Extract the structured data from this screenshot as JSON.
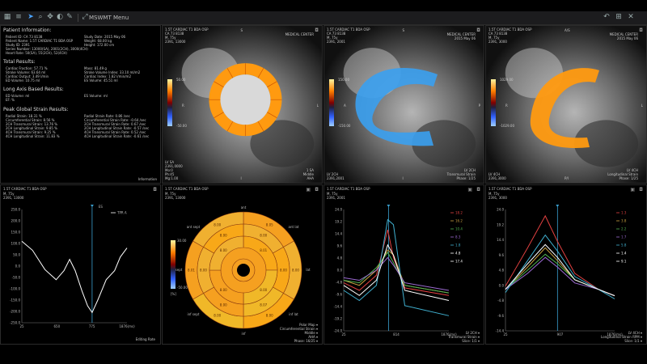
{
  "app": {
    "title": "MSWMT Menu"
  },
  "info": {
    "patient_header": "Patient Information:",
    "patient_left": [
      "Patient ID: CA 73 8138",
      "Patient Name: 1.5T CARDIAC T1 BDA OSP",
      "Study ID: 2391",
      "Series Number: 13000(SA), 2001(2CH), 3000(4CH)",
      "Heart Rate: 50(SA), 55(2CH), 52(4CH)"
    ],
    "patient_right": [
      "Study Date: 2015 May 06",
      "Weight: 68.00 kg",
      "Height: 172.00 cm"
    ],
    "total_header": "Total Results:",
    "total_left": [
      "Cardiac Fraction: 57.71 %",
      "Stroke Volume: 63.64 ml",
      "Cardiac Output: 3.49 l/min",
      "ED Volume: 10.75 ml"
    ],
    "total_right": [
      "Mass: 81.49 g",
      "Stroke Volume Index: 33.10 ml/m2",
      "Cardiac Index: 1.82 l/min/m2",
      "ES Volume: 45.51 ml"
    ],
    "long_header": "Long Axis Based Results:",
    "long_left": [
      "ED Volume: ml",
      "EF: %"
    ],
    "long_right": [
      "ES Volume: ml"
    ],
    "strain_header": "Peak Global Strain Results:",
    "strain_left": [
      "Radial Strain: 18.31 %",
      "Circumferential Strain: 8.56 %",
      "2CH Transmural Strain: 13.76 %",
      "2CH Longitudinal Strain: 9.85 %",
      "4CH Transmural Strain: 9.25 %",
      "4CH Longitudinal Strain: 11.83 %"
    ],
    "strain_right": [
      "Radial Strain Rate: 0.86 /sec",
      "Circumferential Strain Rate: -0.64 /sec",
      "2CH Transmural Strain Rate: 0.67 /sec",
      "2CH Longitudinal Strain Rate: -0.57 /sec",
      "4CH Transmural Strain Rate: 0.52 /sec",
      "4CH Longitudinal Strain Rate: -0.61 /sec"
    ],
    "footer": "Information"
  },
  "mri": [
    {
      "title": "1.5T CARDIAC T1 BDA OSP",
      "sub": "CA 73 8138",
      "meta": [
        "M, 75y",
        "2391, 13000",
        "",
        "",
        ""
      ],
      "right_meta": [
        "MEDICAL CENTER"
      ],
      "scale_top": "50.00",
      "scale_bot": "-50.00",
      "dir_top": "S",
      "dir_left": "R",
      "dir_right": "L",
      "dir_bot": "I",
      "bl": [
        "LV SA",
        "2391,0000",
        "Mo:0",
        "Ph:45",
        "Mg:1.00"
      ],
      "br": [
        "1 SA",
        "Middle",
        "AHA"
      ],
      "footer": ""
    },
    {
      "title": "1.5T CARDIAC T1 BDA OSP",
      "sub": "CA 73 8138",
      "meta": [
        "M, 75y",
        "2391, 2001"
      ],
      "right_meta": [
        "MEDICAL CENTER",
        "2015 May 06"
      ],
      "scale_top": "150.00",
      "scale_bot": "-150.00",
      "dir_top": "S",
      "dir_left": "A",
      "dir_right": "P",
      "dir_bot": "I",
      "bl": [
        "LV 2CH",
        "2391,2001"
      ],
      "br": [
        "LV 2CH",
        "Transmural Strain",
        "Phase: 1/25"
      ],
      "footer": ""
    },
    {
      "title": "1.5T CARDIAC T1 BDA OSP",
      "sub": "CA 73 8138",
      "meta": [
        "M, 75y",
        "2391, 3000"
      ],
      "right_meta": [
        "MEDICAL CENTER",
        "2015 May 06"
      ],
      "scale_top": "1029.00",
      "scale_bot": "-1029.00",
      "dir_top": "A/S",
      "dir_left": "R",
      "dir_right": "L",
      "dir_bot": "P/I",
      "bl": [
        "LV 4CH",
        "2391,3000"
      ],
      "br": [
        "LV 4CH",
        "Longitudinal Strain",
        "Phase: 1/25"
      ],
      "footer": ""
    }
  ],
  "curve": {
    "title": "1.5T CARDIAC T1 BDA OSP",
    "meta": [
      "M, 75y",
      "2391, 13000"
    ],
    "chart_data": {
      "type": "line",
      "ylim": [
        -250,
        250
      ],
      "yticks": [
        "250.0",
        "200.0",
        "150.0",
        "100.0",
        "50.0",
        "0.0",
        "-50.0",
        "-100.0",
        "-150.0",
        "-200.0",
        "-250.0"
      ],
      "xticks": [
        "25",
        "650",
        "775",
        "1876(ms)"
      ],
      "legend": "TPR A",
      "series": [
        {
          "values": [
            [
              25,
              110
            ],
            [
              120,
              70
            ],
            [
              230,
              -15
            ],
            [
              330,
              -60
            ],
            [
              400,
              -20
            ],
            [
              450,
              30
            ],
            [
              500,
              -20
            ],
            [
              560,
              -110
            ],
            [
              610,
              -175
            ],
            [
              650,
              -205
            ],
            [
              700,
              -150
            ],
            [
              775,
              -60
            ],
            [
              850,
              -20
            ],
            [
              900,
              40
            ],
            [
              960,
              80
            ]
          ]
        }
      ],
      "marker_x": 650,
      "marker_label": "ES"
    },
    "footer": "Editing Rate"
  },
  "bullseye": {
    "title": "1.5T CARDIAC T1 BDA OSP",
    "meta": [
      "M, 75y",
      "2391, 13000"
    ],
    "scale_top": "30.00",
    "scale_bot": "-50.00",
    "scale_unit": "[%]",
    "labels": {
      "top": "ant",
      "bottom": "inf",
      "left": "sept",
      "right": "lat",
      "ant_sept": "ant sept",
      "inf_sept": "inf sept",
      "ant_lat": "ant lat",
      "inf_lat": "inf lat"
    },
    "segments": [
      "8.05",
      "8.00",
      "8.00",
      "8.00",
      "8.01",
      "8.00",
      "8.00",
      "8.00",
      "8.07",
      "8.00",
      "8.00",
      "8.00",
      "8.01",
      "8.00",
      "8.00",
      "8.00"
    ],
    "controls": [
      "Polar Map",
      "Circumferential Strain",
      "Middle",
      "AHA",
      "Phase: 16/25"
    ]
  },
  "strain2ch": {
    "title": "1.5T CARDIAC T1 BDA OSP",
    "meta": [
      "M, 75y",
      "2391, 2001"
    ],
    "chart_data": {
      "type": "line",
      "ylim": [
        -24,
        24
      ],
      "yticks": [
        "24.0",
        "19.2",
        "14.4",
        "9.6",
        "4.8",
        "0.0",
        "-4.8",
        "-9.6",
        "-14.4",
        "-19.2",
        "-24.0"
      ],
      "xticks": [
        "25",
        "814",
        "1876(ms)"
      ],
      "legend": [
        "18.2",
        "16.2",
        "10.4",
        "8.3",
        "1.8",
        "4.8",
        "17.4"
      ],
      "series": [
        {
          "color": "#e04040",
          "values": [
            [
              25,
              -5
            ],
            [
              300,
              -8
            ],
            [
              600,
              -2
            ],
            [
              800,
              16
            ],
            [
              900,
              5
            ],
            [
              1100,
              -7
            ],
            [
              1876,
              -10
            ]
          ]
        },
        {
          "color": "#c9a040",
          "values": [
            [
              25,
              -4
            ],
            [
              300,
              -6
            ],
            [
              600,
              0
            ],
            [
              800,
              8
            ],
            [
              900,
              6
            ],
            [
              1100,
              -6
            ],
            [
              1876,
              -9
            ]
          ]
        },
        {
          "color": "#50b050",
          "values": [
            [
              25,
              -4
            ],
            [
              300,
              -5
            ],
            [
              600,
              1
            ],
            [
              800,
              7
            ],
            [
              900,
              3
            ],
            [
              1100,
              -6
            ],
            [
              1876,
              -9
            ]
          ]
        },
        {
          "color": "#9a6ad0",
          "values": [
            [
              25,
              -3
            ],
            [
              300,
              -4
            ],
            [
              600,
              0
            ],
            [
              800,
              5
            ],
            [
              900,
              2
            ],
            [
              1100,
              -5
            ],
            [
              1876,
              -8
            ]
          ]
        },
        {
          "color": "#40b0d0",
          "values": [
            [
              25,
              -8
            ],
            [
              300,
              -12
            ],
            [
              600,
              -6
            ],
            [
              800,
              20
            ],
            [
              900,
              18
            ],
            [
              1100,
              -14
            ],
            [
              1876,
              -18
            ]
          ]
        },
        {
          "color": "#ffffff",
          "values": [
            [
              25,
              -6
            ],
            [
              300,
              -10
            ],
            [
              600,
              -4
            ],
            [
              800,
              10
            ],
            [
              900,
              6
            ],
            [
              1100,
              -8
            ],
            [
              1876,
              -12
            ]
          ]
        }
      ],
      "marker_x": 814
    },
    "controls": [
      "LV 2CH",
      "Transmural Strain",
      "Slice: 1/1"
    ]
  },
  "strain4ch": {
    "title": "1.5T CARDIAC T1 BDA OSP",
    "meta": [
      "M, 75y",
      "2391, 3000"
    ],
    "chart_data": {
      "type": "line",
      "ylim": [
        -14,
        24
      ],
      "yticks": [
        "24.0",
        "19.2",
        "14.4",
        "9.6",
        "4.8",
        "0.0",
        "-4.8",
        "-9.6",
        "-14.4"
      ],
      "xticks": [
        "25",
        "907",
        "1876(ms)"
      ],
      "legend": [
        "1.3",
        "3.8",
        "2.2",
        "1.7",
        "5.8",
        "1.4",
        "9.1"
      ],
      "series": [
        {
          "color": "#e04040",
          "values": [
            [
              25,
              0
            ],
            [
              400,
              12
            ],
            [
              700,
              22
            ],
            [
              907,
              14
            ],
            [
              1200,
              4
            ],
            [
              1600,
              -1
            ],
            [
              1876,
              -3
            ]
          ]
        },
        {
          "color": "#c9a040",
          "values": [
            [
              25,
              -1
            ],
            [
              400,
              6
            ],
            [
              700,
              12
            ],
            [
              907,
              8
            ],
            [
              1200,
              2
            ],
            [
              1600,
              -1
            ],
            [
              1876,
              -3
            ]
          ]
        },
        {
          "color": "#50b050",
          "values": [
            [
              25,
              -1
            ],
            [
              400,
              5
            ],
            [
              700,
              10
            ],
            [
              907,
              7
            ],
            [
              1200,
              2
            ],
            [
              1600,
              -1
            ],
            [
              1876,
              -3
            ]
          ]
        },
        {
          "color": "#9a6ad0",
          "values": [
            [
              25,
              -1
            ],
            [
              400,
              4
            ],
            [
              700,
              9
            ],
            [
              907,
              6
            ],
            [
              1200,
              1
            ],
            [
              1600,
              -1
            ],
            [
              1876,
              -3
            ]
          ]
        },
        {
          "color": "#40b0d0",
          "values": [
            [
              25,
              -2
            ],
            [
              400,
              8
            ],
            [
              700,
              16
            ],
            [
              907,
              11
            ],
            [
              1200,
              3
            ],
            [
              1600,
              -1
            ],
            [
              1876,
              -4
            ]
          ]
        },
        {
          "color": "#ffffff",
          "values": [
            [
              25,
              -1
            ],
            [
              400,
              7
            ],
            [
              700,
              13
            ],
            [
              907,
              9
            ],
            [
              1200,
              2
            ],
            [
              1600,
              -1
            ],
            [
              1876,
              -3
            ]
          ]
        }
      ],
      "marker_x": 907
    },
    "controls": [
      "LV 4CH",
      "Longitudinal Strain RPM",
      "Slice: 1/1"
    ]
  }
}
